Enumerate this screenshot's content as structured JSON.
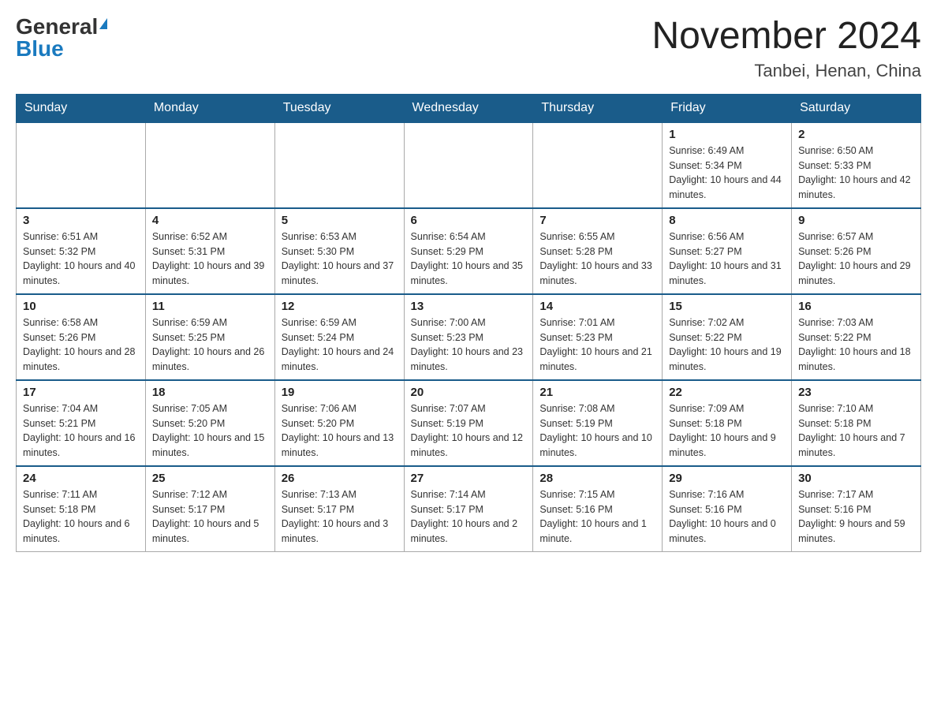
{
  "header": {
    "logo_general": "General",
    "logo_blue": "Blue",
    "month_title": "November 2024",
    "location": "Tanbei, Henan, China"
  },
  "days_of_week": [
    "Sunday",
    "Monday",
    "Tuesday",
    "Wednesday",
    "Thursday",
    "Friday",
    "Saturday"
  ],
  "weeks": [
    [
      {
        "day": "",
        "info": ""
      },
      {
        "day": "",
        "info": ""
      },
      {
        "day": "",
        "info": ""
      },
      {
        "day": "",
        "info": ""
      },
      {
        "day": "",
        "info": ""
      },
      {
        "day": "1",
        "info": "Sunrise: 6:49 AM\nSunset: 5:34 PM\nDaylight: 10 hours and 44 minutes."
      },
      {
        "day": "2",
        "info": "Sunrise: 6:50 AM\nSunset: 5:33 PM\nDaylight: 10 hours and 42 minutes."
      }
    ],
    [
      {
        "day": "3",
        "info": "Sunrise: 6:51 AM\nSunset: 5:32 PM\nDaylight: 10 hours and 40 minutes."
      },
      {
        "day": "4",
        "info": "Sunrise: 6:52 AM\nSunset: 5:31 PM\nDaylight: 10 hours and 39 minutes."
      },
      {
        "day": "5",
        "info": "Sunrise: 6:53 AM\nSunset: 5:30 PM\nDaylight: 10 hours and 37 minutes."
      },
      {
        "day": "6",
        "info": "Sunrise: 6:54 AM\nSunset: 5:29 PM\nDaylight: 10 hours and 35 minutes."
      },
      {
        "day": "7",
        "info": "Sunrise: 6:55 AM\nSunset: 5:28 PM\nDaylight: 10 hours and 33 minutes."
      },
      {
        "day": "8",
        "info": "Sunrise: 6:56 AM\nSunset: 5:27 PM\nDaylight: 10 hours and 31 minutes."
      },
      {
        "day": "9",
        "info": "Sunrise: 6:57 AM\nSunset: 5:26 PM\nDaylight: 10 hours and 29 minutes."
      }
    ],
    [
      {
        "day": "10",
        "info": "Sunrise: 6:58 AM\nSunset: 5:26 PM\nDaylight: 10 hours and 28 minutes."
      },
      {
        "day": "11",
        "info": "Sunrise: 6:59 AM\nSunset: 5:25 PM\nDaylight: 10 hours and 26 minutes."
      },
      {
        "day": "12",
        "info": "Sunrise: 6:59 AM\nSunset: 5:24 PM\nDaylight: 10 hours and 24 minutes."
      },
      {
        "day": "13",
        "info": "Sunrise: 7:00 AM\nSunset: 5:23 PM\nDaylight: 10 hours and 23 minutes."
      },
      {
        "day": "14",
        "info": "Sunrise: 7:01 AM\nSunset: 5:23 PM\nDaylight: 10 hours and 21 minutes."
      },
      {
        "day": "15",
        "info": "Sunrise: 7:02 AM\nSunset: 5:22 PM\nDaylight: 10 hours and 19 minutes."
      },
      {
        "day": "16",
        "info": "Sunrise: 7:03 AM\nSunset: 5:22 PM\nDaylight: 10 hours and 18 minutes."
      }
    ],
    [
      {
        "day": "17",
        "info": "Sunrise: 7:04 AM\nSunset: 5:21 PM\nDaylight: 10 hours and 16 minutes."
      },
      {
        "day": "18",
        "info": "Sunrise: 7:05 AM\nSunset: 5:20 PM\nDaylight: 10 hours and 15 minutes."
      },
      {
        "day": "19",
        "info": "Sunrise: 7:06 AM\nSunset: 5:20 PM\nDaylight: 10 hours and 13 minutes."
      },
      {
        "day": "20",
        "info": "Sunrise: 7:07 AM\nSunset: 5:19 PM\nDaylight: 10 hours and 12 minutes."
      },
      {
        "day": "21",
        "info": "Sunrise: 7:08 AM\nSunset: 5:19 PM\nDaylight: 10 hours and 10 minutes."
      },
      {
        "day": "22",
        "info": "Sunrise: 7:09 AM\nSunset: 5:18 PM\nDaylight: 10 hours and 9 minutes."
      },
      {
        "day": "23",
        "info": "Sunrise: 7:10 AM\nSunset: 5:18 PM\nDaylight: 10 hours and 7 minutes."
      }
    ],
    [
      {
        "day": "24",
        "info": "Sunrise: 7:11 AM\nSunset: 5:18 PM\nDaylight: 10 hours and 6 minutes."
      },
      {
        "day": "25",
        "info": "Sunrise: 7:12 AM\nSunset: 5:17 PM\nDaylight: 10 hours and 5 minutes."
      },
      {
        "day": "26",
        "info": "Sunrise: 7:13 AM\nSunset: 5:17 PM\nDaylight: 10 hours and 3 minutes."
      },
      {
        "day": "27",
        "info": "Sunrise: 7:14 AM\nSunset: 5:17 PM\nDaylight: 10 hours and 2 minutes."
      },
      {
        "day": "28",
        "info": "Sunrise: 7:15 AM\nSunset: 5:16 PM\nDaylight: 10 hours and 1 minute."
      },
      {
        "day": "29",
        "info": "Sunrise: 7:16 AM\nSunset: 5:16 PM\nDaylight: 10 hours and 0 minutes."
      },
      {
        "day": "30",
        "info": "Sunrise: 7:17 AM\nSunset: 5:16 PM\nDaylight: 9 hours and 59 minutes."
      }
    ]
  ]
}
